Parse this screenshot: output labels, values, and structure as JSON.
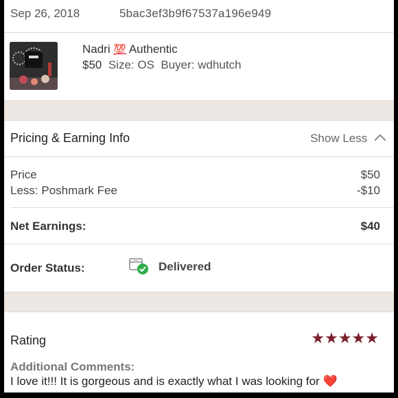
{
  "order": {
    "date": "Sep 26, 2018",
    "id": "5bac3ef3b9f67537a196e949"
  },
  "item": {
    "brand": "Nadri",
    "emoji": "💯",
    "condition": "Authentic",
    "price": "$50",
    "size": "Size: OS",
    "buyer": "Buyer: wdhutch"
  },
  "pricing": {
    "title": "Pricing & Earning Info",
    "toggle_label": "Show Less",
    "price_label": "Price",
    "price_value": "$50",
    "fee_label": "Less: Poshmark Fee",
    "fee_value": "-$10",
    "net_label": "Net Earnings:",
    "net_value": "$40",
    "status_label": "Order Status:",
    "status_value": "Delivered"
  },
  "rating": {
    "title": "Rating",
    "stars": 5,
    "stars_text": "★★★★★",
    "comments_label": "Additional Comments:",
    "comment": "I love it!!! It is gorgeous and is exactly what I was looking for",
    "heart": "❤️"
  },
  "colors": {
    "accent": "#7a1f2a",
    "band": "#ede8e3",
    "delivered_check": "#2eae4b"
  }
}
